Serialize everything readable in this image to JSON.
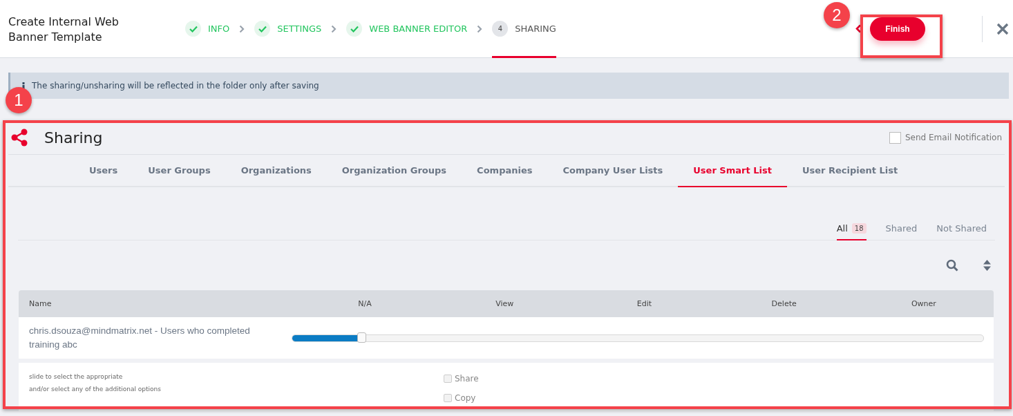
{
  "header": {
    "title": "Create Internal Web Banner Template",
    "steps": [
      {
        "label": "INFO",
        "done": true,
        "selected": false
      },
      {
        "label": "SETTINGS",
        "done": true,
        "selected": false
      },
      {
        "label": "WEB BANNER EDITOR",
        "done": true,
        "selected": false
      },
      {
        "number": "4",
        "label": "SHARING",
        "done": false,
        "selected": true
      }
    ],
    "finish": "Finish"
  },
  "info": "The sharing/unsharing will be reflected in the folder only after saving",
  "annotations": [
    {
      "label": "1"
    },
    {
      "label": "2"
    }
  ],
  "sharing": {
    "title": "Sharing",
    "notify": {
      "label": "Send Email Notification",
      "checked": false
    },
    "tabs": [
      {
        "label": "Users",
        "selected": false
      },
      {
        "label": "User Groups",
        "selected": false
      },
      {
        "label": "Organizations",
        "selected": false
      },
      {
        "label": "Organization Groups",
        "selected": false
      },
      {
        "label": "Companies",
        "selected": false
      },
      {
        "label": "Company User Lists",
        "selected": false
      },
      {
        "label": "User Smart List",
        "selected": true
      },
      {
        "label": "User Recipient List",
        "selected": false
      }
    ],
    "filters": [
      {
        "label": "All",
        "count": "18",
        "selected": true
      },
      {
        "label": "Shared",
        "selected": false
      },
      {
        "label": "Not Shared",
        "selected": false
      }
    ],
    "columns": [
      "Name",
      "N/A",
      "View",
      "Edit",
      "Delete",
      "Owner"
    ],
    "rows": [
      {
        "name": "chris.dsouza@mindmatrix.net - Users who completed training abc",
        "level": 0.1
      }
    ],
    "hints": [
      "slide to select the appropriate",
      "and/or select any of the additional options"
    ],
    "options": [
      {
        "label": "Share",
        "checked": false,
        "disabled": true
      },
      {
        "label": "Copy",
        "checked": false,
        "disabled": true
      }
    ]
  }
}
